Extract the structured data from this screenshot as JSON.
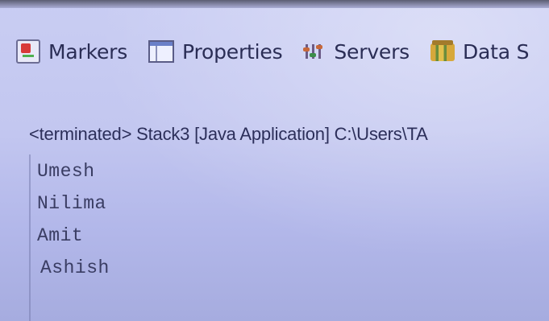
{
  "tabs": [
    {
      "label": "Markers",
      "icon": "markers-icon"
    },
    {
      "label": "Properties",
      "icon": "properties-icon"
    },
    {
      "label": "Servers",
      "icon": "servers-icon"
    },
    {
      "label": "Data S",
      "icon": "data-source-icon"
    }
  ],
  "console": {
    "header": "<terminated> Stack3 [Java Application] C:\\Users\\TA",
    "lines": [
      "Umesh",
      "Nilima",
      "Amit",
      "Ashish"
    ]
  }
}
